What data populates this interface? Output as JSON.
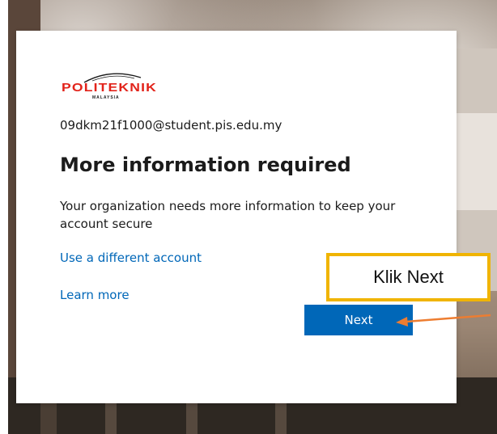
{
  "brand": {
    "logo_text": "POLITEKNIK",
    "logo_subtext": "MALAYSIA",
    "logo_color": "#e2231a"
  },
  "account": {
    "email": "09dkm21f1000@student.pis.edu.my"
  },
  "dialog": {
    "title": "More information required",
    "description": "Your organization needs more information to keep your account secure",
    "use_different_account_label": "Use a different account",
    "learn_more_label": "Learn more",
    "next_label": "Next"
  },
  "annotation": {
    "callout_text": "Klik Next",
    "callout_border_color": "#f0b400",
    "arrow_color": "#ed7d31"
  },
  "colors": {
    "link": "#0067b8",
    "primary_button": "#0067b8"
  }
}
